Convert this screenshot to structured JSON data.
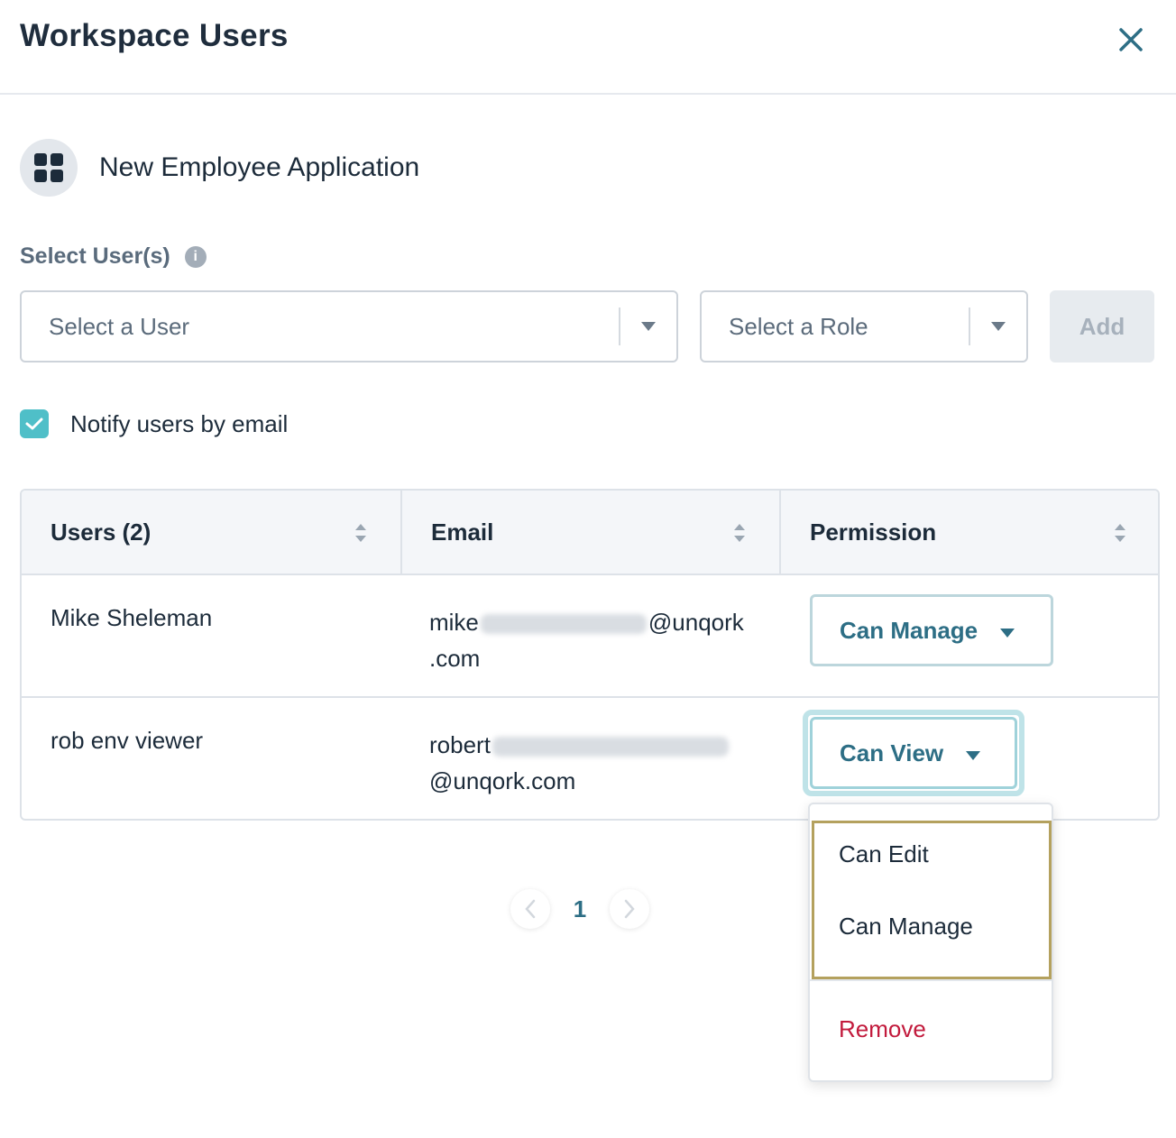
{
  "header": {
    "title": "Workspace Users",
    "close_icon": "close-icon"
  },
  "app": {
    "icon": "grid-icon",
    "name": "New Employee Application"
  },
  "select": {
    "label": "Select User(s)",
    "info_icon": "i",
    "user_placeholder": "Select a User",
    "role_placeholder": "Select a Role",
    "add_label": "Add"
  },
  "notify": {
    "checked": true,
    "label": "Notify users by email"
  },
  "table": {
    "columns": [
      "Users (2)",
      "Email",
      "Permission"
    ],
    "rows": [
      {
        "name": "Mike Sheleman",
        "email_prefix": "mike",
        "email_suffix": "@unqork",
        "email_line2": ".com",
        "permission": "Can Manage"
      },
      {
        "name": "rob env viewer",
        "email_prefix": "robert",
        "email_suffix": "",
        "email_line2": "@unqork.com",
        "permission": "Can View"
      }
    ]
  },
  "pagination": {
    "current": "1"
  },
  "permission_menu": {
    "items": [
      "Can Edit",
      "Can Manage"
    ],
    "remove": "Remove"
  },
  "colors": {
    "accent": "#2d6e85",
    "checkbox": "#4fbfc8",
    "danger": "#c21a3c",
    "focus": "#b4a15e"
  }
}
